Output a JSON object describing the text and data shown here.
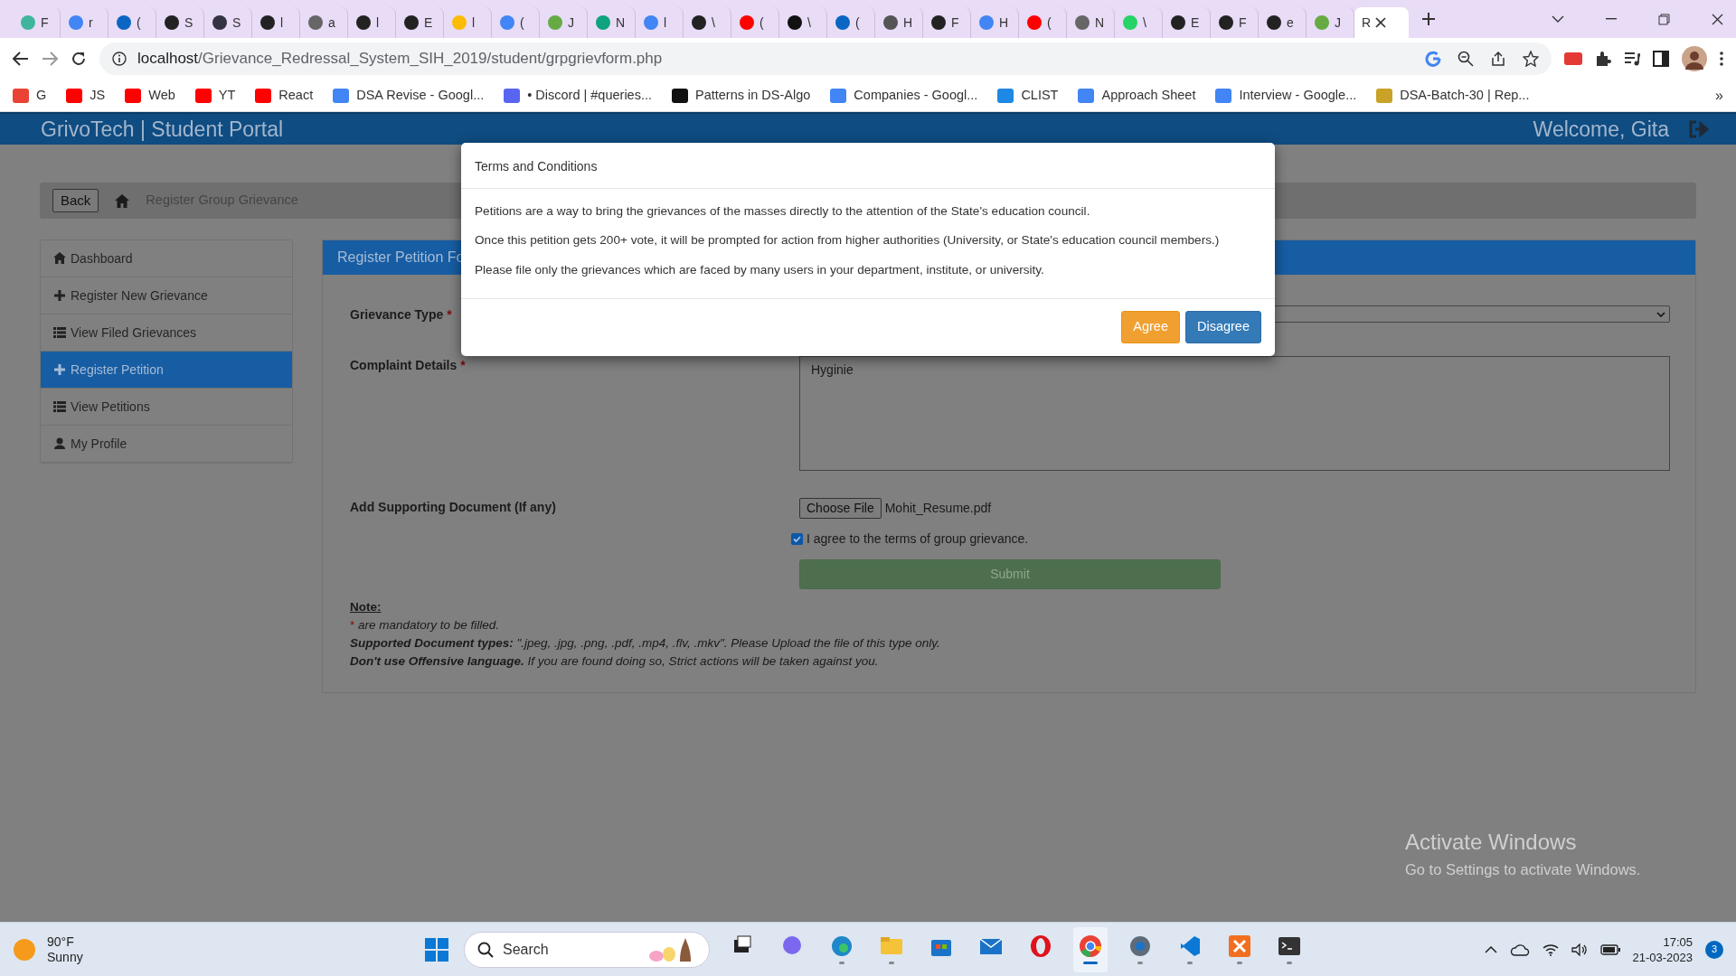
{
  "browser": {
    "tabs": [
      {
        "label": "F",
        "selected": false
      },
      {
        "label": "r",
        "selected": false
      },
      {
        "label": "(",
        "selected": false
      },
      {
        "label": "S",
        "selected": false
      },
      {
        "label": "S",
        "selected": false
      },
      {
        "label": "l",
        "selected": false
      },
      {
        "label": "a",
        "selected": false
      },
      {
        "label": "l",
        "selected": false
      },
      {
        "label": "E",
        "selected": false
      },
      {
        "label": "l",
        "selected": false
      },
      {
        "label": "(",
        "selected": false
      },
      {
        "label": "J",
        "selected": false
      },
      {
        "label": "N",
        "selected": false
      },
      {
        "label": "l",
        "selected": false
      },
      {
        "label": "\\",
        "selected": false
      },
      {
        "label": "(",
        "selected": false
      },
      {
        "label": "\\",
        "selected": false
      },
      {
        "label": "(",
        "selected": false
      },
      {
        "label": "H",
        "selected": false
      },
      {
        "label": "F",
        "selected": false
      },
      {
        "label": "H",
        "selected": false
      },
      {
        "label": "(",
        "selected": false
      },
      {
        "label": "N",
        "selected": false
      },
      {
        "label": "\\",
        "selected": false
      },
      {
        "label": "E",
        "selected": false
      },
      {
        "label": "F",
        "selected": false
      },
      {
        "label": "e",
        "selected": false
      },
      {
        "label": "J",
        "selected": false
      },
      {
        "label": "R",
        "selected": true
      }
    ],
    "address": {
      "host": "localhost",
      "path": "/Grievance_Redressal_System_SIH_2019/student/grpgrievform.php"
    },
    "bookmarks": [
      "G",
      "JS",
      "Web",
      "YT",
      "React",
      "DSA Revise - Googl...",
      "• Discord | #queries...",
      "Patterns in DS-Algo",
      "Companies - Googl...",
      "CLIST",
      "Approach Sheet",
      "Interview - Google...",
      "DSA-Batch-30 | Rep..."
    ],
    "bookmarks_more": "»"
  },
  "page": {
    "brand": "GrivoTech | Student Portal",
    "welcome": "Welcome, Gita",
    "breadcrumb": {
      "back": "Back",
      "current": "Register Group Grievance"
    },
    "sidebar": [
      {
        "label": "Dashboard",
        "selected": false
      },
      {
        "label": "Register New Grievance",
        "selected": false
      },
      {
        "label": "View Filed Grievances",
        "selected": false
      },
      {
        "label": "Register Petition",
        "selected": true
      },
      {
        "label": "View Petitions",
        "selected": false
      },
      {
        "label": "My Profile",
        "selected": false
      }
    ],
    "panel_title": "Register Petition Fo",
    "form": {
      "grievance_type": {
        "label": "Grievance Type",
        "mark": "*"
      },
      "complaint": {
        "label": "Complaint Details",
        "mark": "*",
        "value": "Hyginie"
      },
      "document": {
        "label": "Add Supporting Document (If any)",
        "button": "Choose File",
        "file": "Mohit_Resume.pdf"
      },
      "agree": {
        "label": "I agree to the terms of group grievance.",
        "checked": true
      },
      "submit": "Submit"
    },
    "note": {
      "title": "Note:",
      "mandatory_mark": "*",
      "mandatory": "are mandatory to be filled.",
      "lines": [
        "**Supported Document types:** \".jpeg, .jpg, .png, .pdf, .mp4, .flv, .mkv\". Please Upload the file of this type only.",
        "**Don't use Offensive language.** If you are found doing so, Strict actions will be taken against you."
      ]
    }
  },
  "modal": {
    "title": "Terms and Conditions",
    "paragraphs": [
      "Petitions are a way to bring the grievances of the masses directly to the attention of the State's education council.",
      "Once this petition gets 200+ vote, it will be prompted for action from higher authorities (University, or State's education council members.)",
      "Please file only the grievances which are faced by many users in your department, institute, or university."
    ],
    "buttons": [
      {
        "label": "Agree",
        "kind": "warning"
      },
      {
        "label": "Disagree",
        "kind": "primary"
      }
    ]
  },
  "watermark": {
    "title": "Activate Windows",
    "subtitle": "Go to Settings to activate Windows."
  },
  "taskbar": {
    "weather": {
      "temp": "90°F",
      "condition": "Sunny"
    },
    "search": "Search",
    "apps": [
      {
        "running": false,
        "active": false
      },
      {
        "running": false,
        "active": false
      },
      {
        "running": true,
        "active": false
      },
      {
        "running": true,
        "active": false
      },
      {
        "running": false,
        "active": false
      },
      {
        "running": false,
        "active": false
      },
      {
        "running": false,
        "active": false
      },
      {
        "running": true,
        "active": true
      },
      {
        "running": true,
        "active": false
      },
      {
        "running": true,
        "active": false
      },
      {
        "running": true,
        "active": false
      },
      {
        "running": true,
        "active": false
      }
    ],
    "time": "17:05",
    "date": "21-03-2023",
    "notifications": "3"
  }
}
